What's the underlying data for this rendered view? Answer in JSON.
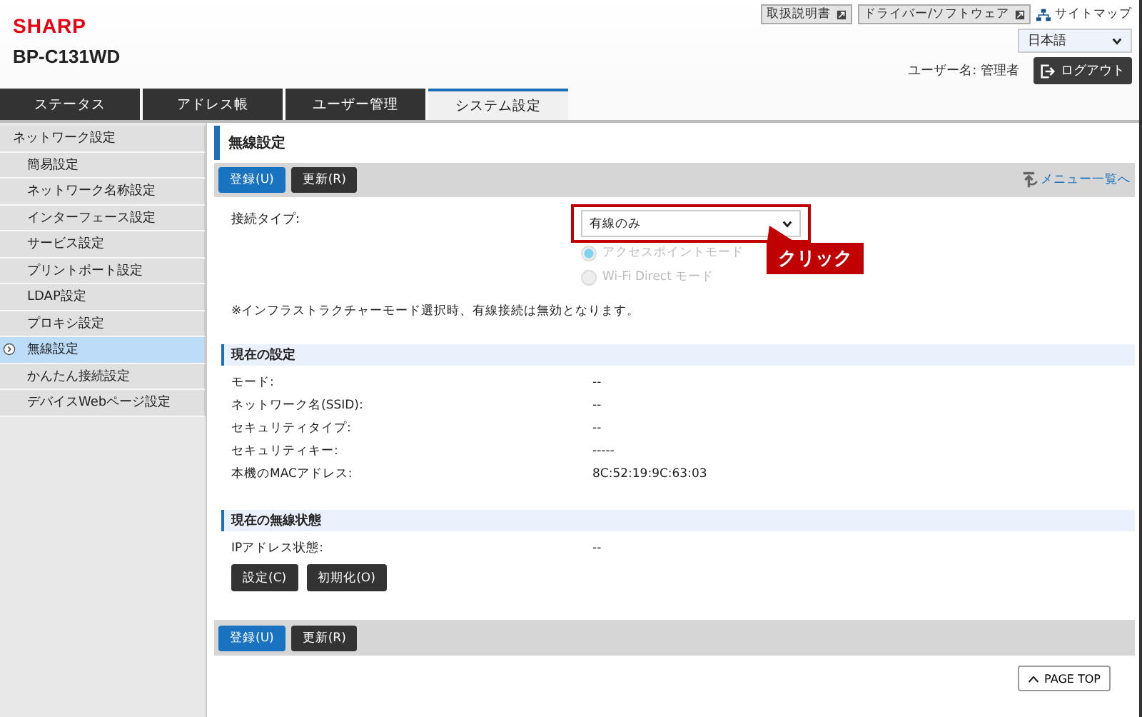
{
  "brand": {
    "logo": "SHARP",
    "model": "BP-C131WD"
  },
  "top_links": [
    {
      "label": "取扱説明書",
      "kind": "external"
    },
    {
      "label": "ドライバー/ソフトウェア",
      "kind": "external"
    },
    {
      "label": "サイトマップ",
      "kind": "sitemap"
    }
  ],
  "language": {
    "value": "日本語"
  },
  "user": {
    "label": "ユーザー名: 管理者",
    "logout": "ログアウト"
  },
  "tabs": [
    {
      "label": "ステータス",
      "selected": false
    },
    {
      "label": "アドレス帳",
      "selected": false
    },
    {
      "label": "ユーザー管理",
      "selected": false
    },
    {
      "label": "システム設定",
      "selected": true
    }
  ],
  "sidebar": {
    "items": [
      {
        "label": "ネットワーク設定",
        "children": [
          {
            "label": "簡易設定",
            "selected": false
          },
          {
            "label": "ネットワーク名称設定",
            "selected": false
          },
          {
            "label": "インターフェース設定",
            "selected": false
          },
          {
            "label": "サービス設定",
            "selected": false
          },
          {
            "label": "プリントポート設定",
            "selected": false
          },
          {
            "label": "LDAP設定",
            "selected": false
          },
          {
            "label": "プロキシ設定",
            "selected": false
          },
          {
            "label": "無線設定",
            "selected": true
          },
          {
            "label": "かんたん接続設定",
            "selected": false
          },
          {
            "label": "デバイスWebページ設定",
            "selected": false
          }
        ]
      }
    ]
  },
  "page": {
    "title": "無線設定",
    "toolbar": {
      "buttons": [
        {
          "label": "登録(U)",
          "kind": "primary"
        },
        {
          "label": "更新(R)",
          "kind": "secondary"
        }
      ],
      "menu_link": "メニュー一覧へ"
    },
    "connection_type": {
      "label": "接続タイプ:",
      "value": "有線のみ",
      "modes": [
        {
          "label": "アクセスポイントモード",
          "selected": true,
          "disabled": true
        },
        {
          "label": "Wi-Fi Direct モード",
          "selected": false,
          "disabled": true
        }
      ]
    },
    "note": "※インフラストラクチャーモード選択時、有線接続は無効となります。",
    "sections": [
      {
        "title": "現在の設定",
        "rows": [
          {
            "label": "モード:",
            "value": "--"
          },
          {
            "label": "ネットワーク名(SSID):",
            "value": "--"
          },
          {
            "label": "セキュリティタイプ:",
            "value": "--"
          },
          {
            "label": "セキュリティキー:",
            "value": "-----"
          },
          {
            "label": "本機のMACアドレス:",
            "value": "8C:52:19:9C:63:03"
          }
        ]
      },
      {
        "title": "現在の無線状態",
        "rows": [
          {
            "label": "IPアドレス状態:",
            "value": "--"
          }
        ],
        "buttons": [
          {
            "label": "設定(C)"
          },
          {
            "label": "初期化(O)"
          }
        ]
      }
    ],
    "bottom_toolbar": {
      "buttons": [
        {
          "label": "登録(U)",
          "kind": "primary"
        },
        {
          "label": "更新(R)",
          "kind": "secondary"
        }
      ]
    },
    "page_top": "PAGE TOP"
  },
  "annotation": {
    "text": "クリック"
  }
}
